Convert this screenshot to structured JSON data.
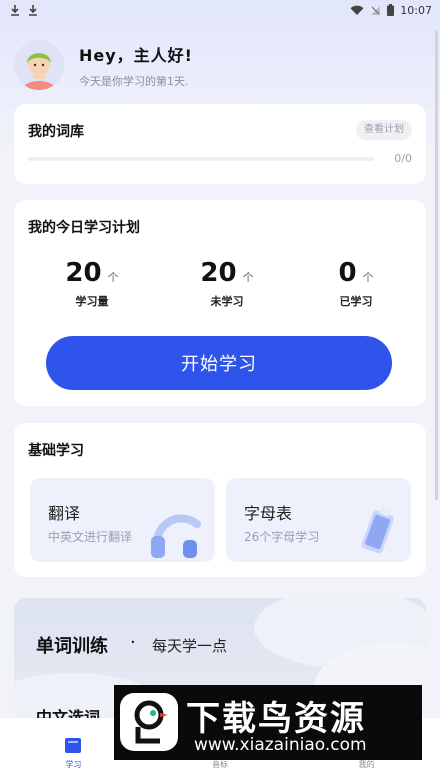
{
  "status_bar": {
    "time": "10:07"
  },
  "header": {
    "title": "Hey，主人好!",
    "subtitle": "今天是你学习的第1天."
  },
  "vocab": {
    "title": "我的词库",
    "plan_button": "查看计划",
    "progress": 0,
    "count": "0/0"
  },
  "today_plan": {
    "title": "我的今日学习计划",
    "stats": [
      {
        "value": "20",
        "unit": "个",
        "label": "学习量"
      },
      {
        "value": "20",
        "unit": "个",
        "label": "未学习"
      },
      {
        "value": "0",
        "unit": "个",
        "label": "已学习"
      }
    ],
    "start_button": "开始学习"
  },
  "basics": {
    "title": "基础学习",
    "tiles": [
      {
        "title": "翻译",
        "subtitle": "中英文进行翻译",
        "icon": "headphones-icon"
      },
      {
        "title": "字母表",
        "subtitle": "26个字母学习",
        "icon": "book-icon"
      }
    ]
  },
  "word_training": {
    "title": "单词训练",
    "separator": "·",
    "subtitle": "每天学一点",
    "next_item": "中文选词"
  },
  "tabbar": {
    "tabs": [
      {
        "label": "学习",
        "active": true
      },
      {
        "label": "音标",
        "active": false
      },
      {
        "label": "我的",
        "active": false
      }
    ]
  },
  "watermark": {
    "name": "下载鸟资源",
    "url": "www.xiazainiao.com"
  },
  "colors": {
    "accent": "#2f54eb",
    "background": "#f2f3f8",
    "card": "#ffffff"
  }
}
